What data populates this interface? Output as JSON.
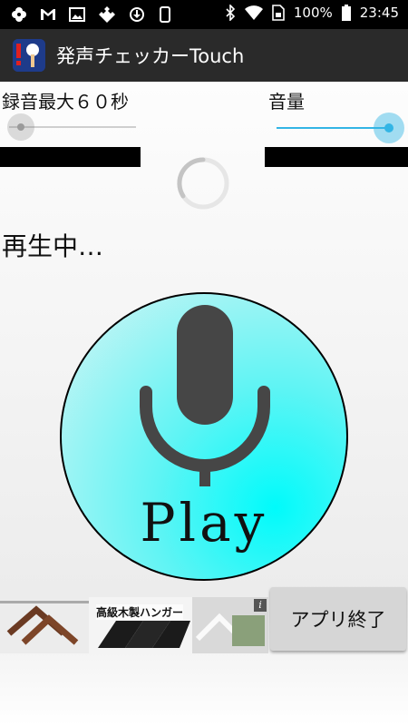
{
  "status_bar": {
    "battery_text": "100%",
    "time": "23:45",
    "left_icons": [
      "pinwheel-icon",
      "gmail-icon",
      "photo-icon",
      "puzzle-icon",
      "update-icon",
      "phone-rotate-icon"
    ],
    "right_icons": [
      "bluetooth-icon",
      "wifi-icon",
      "sim-icon",
      "battery-icon"
    ]
  },
  "app_bar": {
    "title": "発声チェッカーTouch",
    "background": "#2a2a2a"
  },
  "recording": {
    "label": "録音最大６０秒",
    "level": 0.1
  },
  "volume": {
    "label": "音量",
    "level": 1.0,
    "accent": "#33b5e5"
  },
  "status_text": "再生中…",
  "play_button": {
    "label": "Play",
    "icon": "microphone-icon",
    "fill": "#00fbfb"
  },
  "ad": {
    "text": "高級木製ハンガー",
    "info": "i"
  },
  "exit_button": {
    "label": "アプリ終了"
  }
}
